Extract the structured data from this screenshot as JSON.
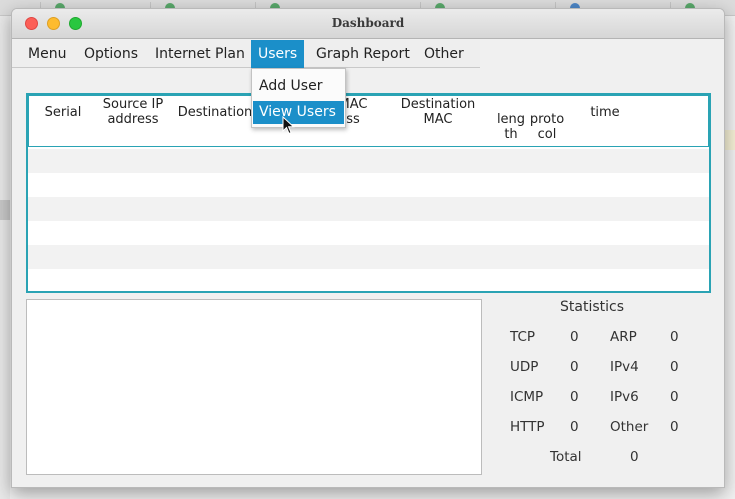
{
  "window": {
    "title": "Dashboard"
  },
  "menubar": {
    "items": [
      {
        "label": "Menu"
      },
      {
        "label": "Options"
      },
      {
        "label": "Internet Plan"
      },
      {
        "label": "Users"
      },
      {
        "label": "Graph Report"
      },
      {
        "label": "Other"
      }
    ],
    "active": "Users"
  },
  "users_menu": {
    "items": [
      {
        "label": "Add User"
      },
      {
        "label": "View Users"
      }
    ],
    "highlighted": "View Users"
  },
  "table": {
    "columns": [
      {
        "line1": "",
        "line2": "Serial"
      },
      {
        "line1": "Source IP",
        "line2": "address"
      },
      {
        "line1": "",
        "line2": "Destination"
      },
      {
        "line1": "MAC",
        "line2": "ss"
      },
      {
        "line1": "Destination",
        "line2": "MAC"
      },
      {
        "line1": "leng",
        "line2": "th"
      },
      {
        "line1": "proto",
        "line2": "col"
      },
      {
        "line1": "",
        "line2": "time"
      }
    ],
    "rows": []
  },
  "statistics": {
    "title": "Statistics",
    "items": [
      {
        "label": "TCP",
        "value": "0"
      },
      {
        "label": "ARP",
        "value": "0"
      },
      {
        "label": "UDP",
        "value": "0"
      },
      {
        "label": "IPv4",
        "value": "0"
      },
      {
        "label": "ICMP",
        "value": "0"
      },
      {
        "label": "IPv6",
        "value": "0"
      },
      {
        "label": "HTTP",
        "value": "0"
      },
      {
        "label": "Other",
        "value": "0"
      }
    ],
    "total_label": "Total",
    "total_value": "0"
  },
  "colors": {
    "accent": "#1b8fc9",
    "table_border": "#2aa3b4"
  }
}
